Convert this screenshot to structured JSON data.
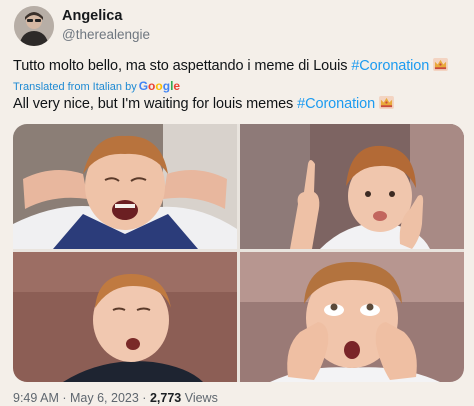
{
  "user": {
    "display_name": "Angelica",
    "handle": "@therealengie",
    "avatar_icon": "profile-photo"
  },
  "tweet": {
    "original_text": "Tutto molto bello, ma sto aspettando i meme di Louis",
    "original_hashtag": "#Coronation",
    "translation_label": "Translated from Italian by",
    "translation_provider": "Google",
    "translated_text": "All very nice, but I'm waiting for louis memes",
    "translated_hashtag": "#Coronation",
    "emoji": "crown-emoji"
  },
  "media": {
    "photos": [
      {
        "subject": "boy-covering-ears-yelling"
      },
      {
        "subject": "boy-pointing-finger-pouting"
      },
      {
        "subject": "boy-head-tilted-back"
      },
      {
        "subject": "boy-hands-on-cheeks"
      }
    ]
  },
  "meta": {
    "time": "9:49 AM",
    "separator": "·",
    "date": "May 6, 2023",
    "views_count": "2,773",
    "views_label": "Views"
  },
  "colors": {
    "background": "#f4efe9",
    "link": "#1d9bf0",
    "muted": "#6f7780"
  }
}
